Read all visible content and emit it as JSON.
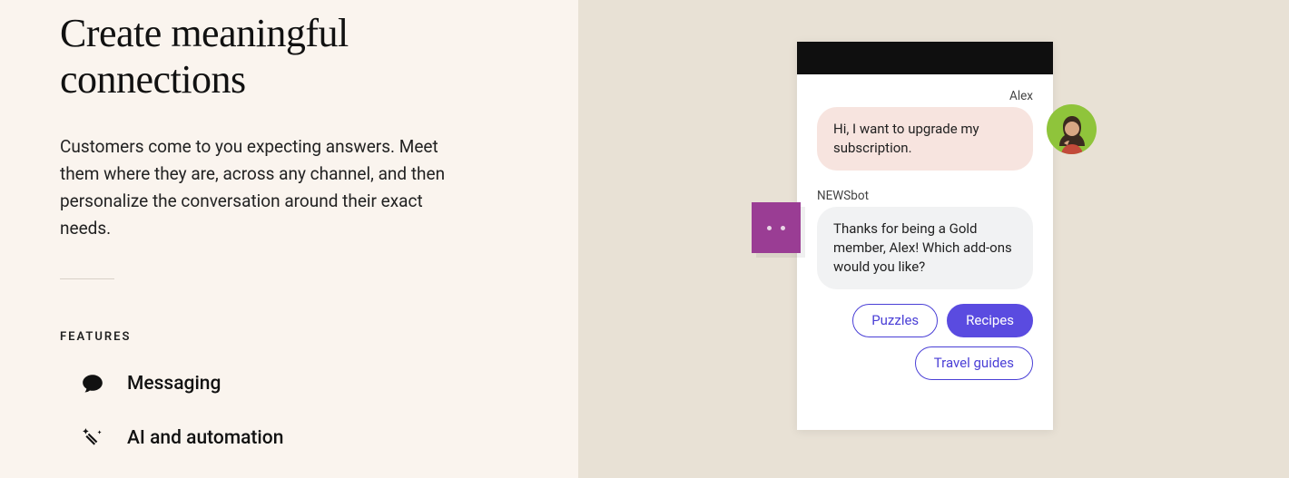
{
  "left": {
    "heading": "Create meaningful connections",
    "body": "Customers come to you expecting answers. Meet them where they are, across any channel, and then personalize the conversation around their exact needs.",
    "features_label": "FEATURES",
    "features": {
      "messaging": "Messaging",
      "ai_automation": "AI and automation"
    }
  },
  "chat": {
    "user_name": "Alex",
    "user_message": "Hi, I want to upgrade my subscription.",
    "bot_name": "NEWSbot",
    "bot_message": "Thanks for being a Gold member, Alex! Which add-ons would you like?",
    "options": {
      "puzzles": "Puzzles",
      "recipes": "Recipes",
      "travel_guides": "Travel guides"
    }
  }
}
